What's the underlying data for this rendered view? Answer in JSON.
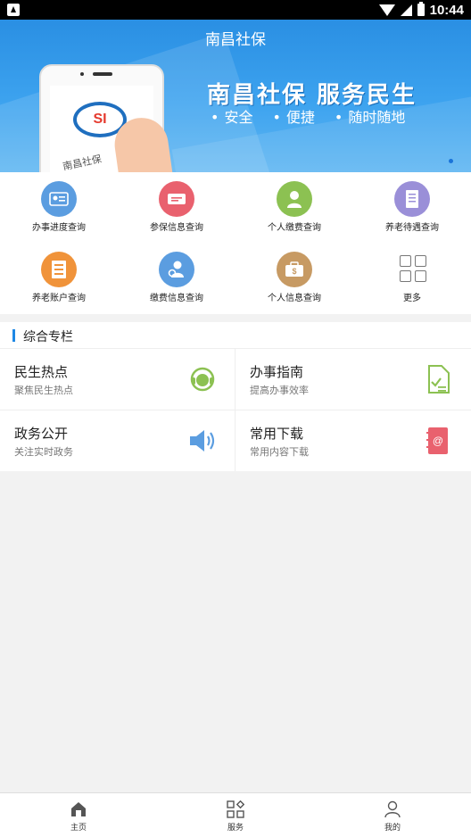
{
  "status_bar": {
    "time": "10:44"
  },
  "header": {
    "title": "南昌社保"
  },
  "banner": {
    "slogan": "南昌社保  服务民生",
    "features": [
      "安全",
      "便捷",
      "随时随地"
    ],
    "card_text": "南昌社保"
  },
  "services": [
    {
      "label": "办事进度查询",
      "icon": "id-card-icon",
      "color": "#5b9de0"
    },
    {
      "label": "参保信息查询",
      "icon": "ticket-icon",
      "color": "#e9616e"
    },
    {
      "label": "个人缴费查询",
      "icon": "person-icon",
      "color": "#8cc152"
    },
    {
      "label": "养老待遇查询",
      "icon": "document-icon",
      "color": "#9a8fd8"
    },
    {
      "label": "养老账户查询",
      "icon": "ledger-icon",
      "color": "#f0933a"
    },
    {
      "label": "缴费信息查询",
      "icon": "user-search-icon",
      "color": "#5b9de0"
    },
    {
      "label": "个人信息查询",
      "icon": "wallet-icon",
      "color": "#c79a63"
    },
    {
      "label": "更多",
      "icon": "grid-icon",
      "color": "#777777"
    }
  ],
  "section": {
    "title": "综合专栏"
  },
  "cards": [
    {
      "title": "民生热点",
      "subtitle": "聚焦民生热点",
      "icon": "headset-icon",
      "color": "#8cc152"
    },
    {
      "title": "办事指南",
      "subtitle": "提高办事效率",
      "icon": "checklist-icon",
      "color": "#8cc152"
    },
    {
      "title": "政务公开",
      "subtitle": "关注实时政务",
      "icon": "speaker-icon",
      "color": "#5b9de0"
    },
    {
      "title": "常用下载",
      "subtitle": "常用内容下载",
      "icon": "address-book-icon",
      "color": "#e9616e"
    }
  ],
  "bottom_nav": [
    {
      "label": "主页",
      "icon": "home-icon"
    },
    {
      "label": "服务",
      "icon": "apps-icon"
    },
    {
      "label": "我的",
      "icon": "user-icon"
    }
  ]
}
